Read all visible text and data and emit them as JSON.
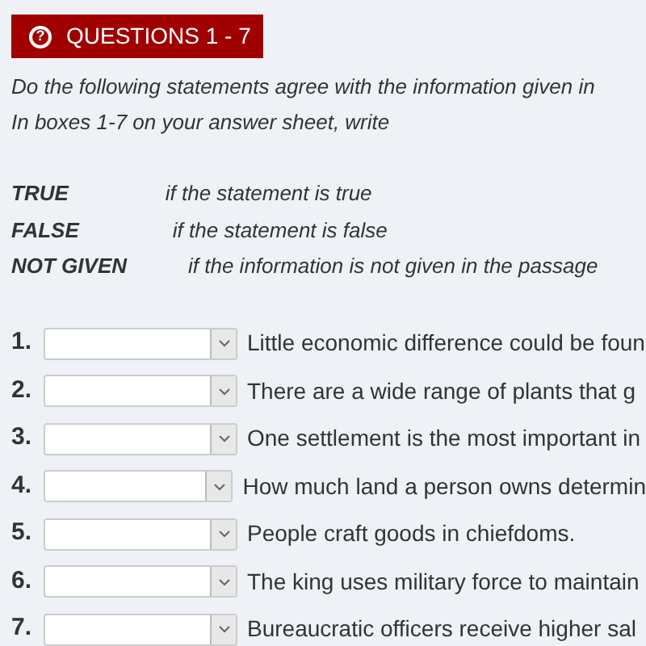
{
  "header": {
    "icon": "?",
    "title": "QUESTIONS 1 - 7"
  },
  "instructions": [
    "Do the following statements agree with the information given in",
    "In boxes 1-7 on your answer sheet, write"
  ],
  "legend": [
    {
      "term": "TRUE",
      "meaning": "if the statement is true"
    },
    {
      "term": "FALSE",
      "meaning": "if the statement is false"
    },
    {
      "term": "NOT GIVEN",
      "meaning": "if the information is not given in the passage"
    }
  ],
  "questions": [
    {
      "number": "1.",
      "statement": "Little economic difference could be foun"
    },
    {
      "number": "2.",
      "statement": "There are a wide range of plants that g"
    },
    {
      "number": "3.",
      "statement": "One settlement is the most important in"
    },
    {
      "number": "4.",
      "statement": "How much land a person owns determin"
    },
    {
      "number": "5.",
      "statement": "People craft goods in chiefdoms."
    },
    {
      "number": "6.",
      "statement": "The king uses military force to maintain"
    },
    {
      "number": "7.",
      "statement": "Bureaucratic officers receive higher sal"
    }
  ]
}
